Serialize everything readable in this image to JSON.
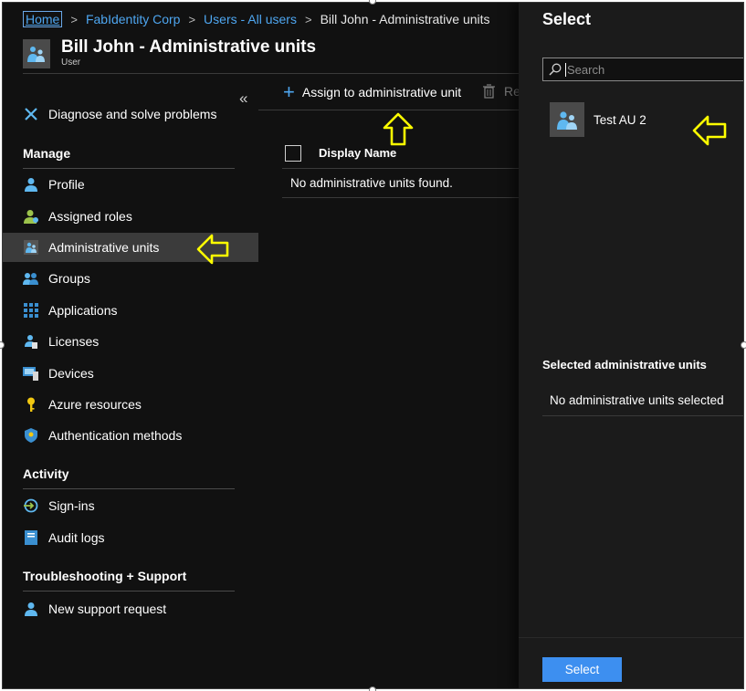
{
  "breadcrumb": {
    "items": [
      "Home",
      "FabIdentity Corp",
      "Users - All users",
      "Bill John - Administrative units"
    ],
    "separator": ">"
  },
  "header": {
    "title": "Bill John - Administrative units",
    "subtitle": "User",
    "icon": "admin-unit-icon"
  },
  "sidebar": {
    "collapse_glyph": "«",
    "diagnose": "Diagnose and solve problems",
    "sections": {
      "manage": "Manage",
      "activity": "Activity",
      "troubleshooting": "Troubleshooting + Support"
    },
    "items": [
      {
        "label": "Profile",
        "icon": "user-icon"
      },
      {
        "label": "Assigned roles",
        "icon": "roles-icon"
      },
      {
        "label": "Administrative units",
        "icon": "admin-unit-icon",
        "selected": true
      },
      {
        "label": "Groups",
        "icon": "groups-icon"
      },
      {
        "label": "Applications",
        "icon": "applications-icon"
      },
      {
        "label": "Licenses",
        "icon": "licenses-icon"
      },
      {
        "label": "Devices",
        "icon": "devices-icon"
      },
      {
        "label": "Azure resources",
        "icon": "key-icon"
      },
      {
        "label": "Authentication methods",
        "icon": "shield-icon"
      },
      {
        "label": "Sign-ins",
        "icon": "signin-icon"
      },
      {
        "label": "Audit logs",
        "icon": "audit-log-icon"
      },
      {
        "label": "New support request",
        "icon": "support-user-icon"
      }
    ]
  },
  "toolbar": {
    "assign_label": "Assign to administrative unit",
    "remove_label": "Re"
  },
  "grid": {
    "columns": [
      "Display Name"
    ],
    "empty_message": "No administrative units found."
  },
  "panel": {
    "title": "Select",
    "search_placeholder": "Search",
    "results": [
      {
        "name": "Test AU 2",
        "icon": "admin-unit-icon"
      }
    ],
    "selected_title": "Selected administrative units",
    "selected_empty": "No administrative units selected",
    "select_button": "Select"
  },
  "colors": {
    "background": "#111111",
    "panel": "#1b1b1b",
    "link": "#4ea6f0",
    "accent_button": "#3d8ff0",
    "selected_row": "#3b3b3b",
    "annotation_arrow": "#ffff00"
  }
}
